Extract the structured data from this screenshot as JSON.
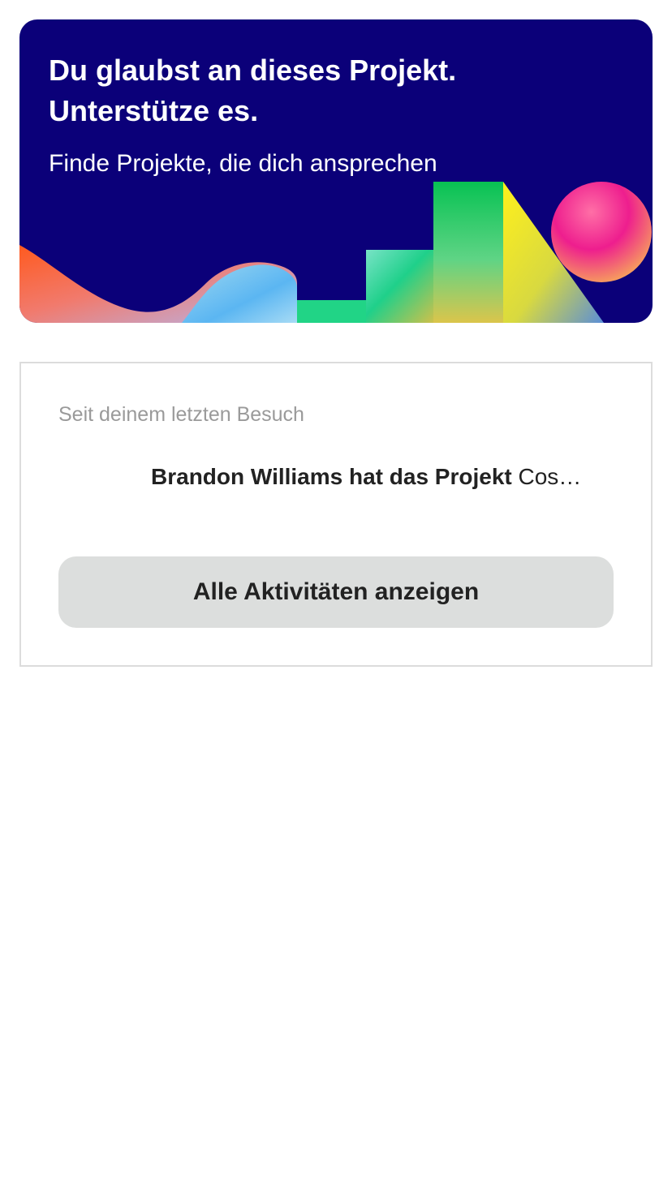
{
  "banner": {
    "title": "Du glaubst an dieses Projekt.\nUnterstütze es.",
    "subtitle": "Finde Projekte, die dich ansprechen",
    "background_color": "#0b0079"
  },
  "activity": {
    "heading": "Seit deinem letzten Besuch",
    "item": {
      "actor_text": "Brandon Williams hat das Projekt",
      "project_text": "Cos…"
    },
    "button_label": "Alle Aktivitäten anzeigen"
  }
}
